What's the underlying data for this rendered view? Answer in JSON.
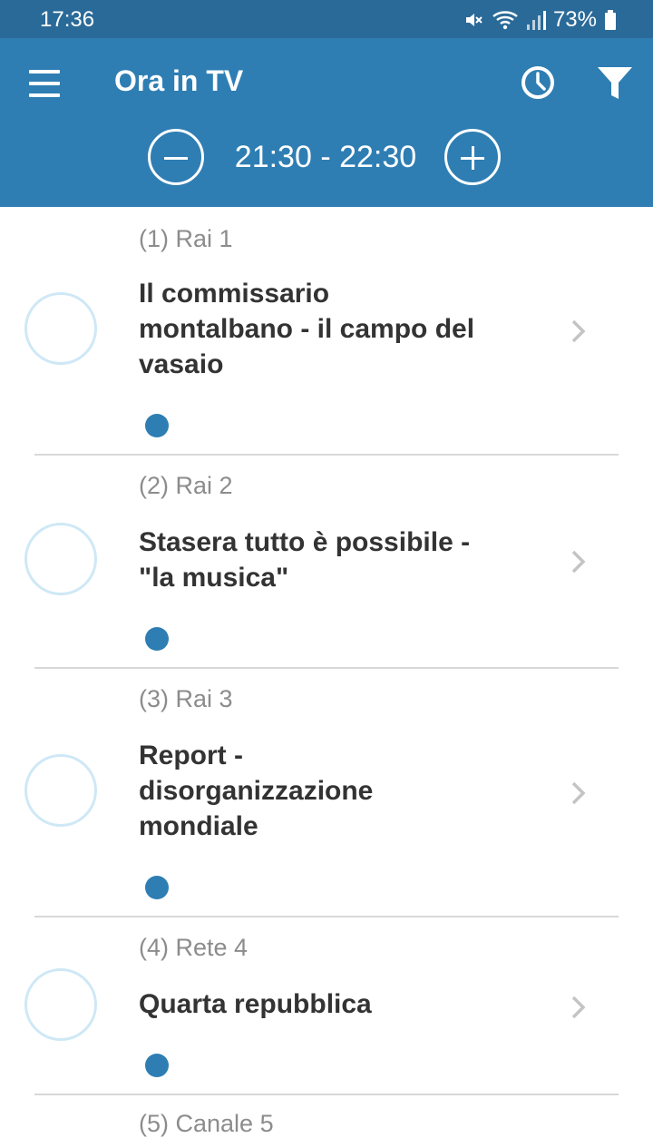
{
  "status_bar": {
    "time": "17:36",
    "battery": "73%",
    "icons": [
      "mute-icon",
      "wifi-icon",
      "signal-icon",
      "battery-icon"
    ]
  },
  "header": {
    "title": "Ora in TV",
    "time_range": "21:30 - 22:30",
    "icons": [
      "menu-icon",
      "clock-icon",
      "filter-icon",
      "minus-icon",
      "plus-icon"
    ]
  },
  "colors": {
    "primary": "#2e7eb3",
    "status_bar": "#2a6a98",
    "ring": "#cfe8f6",
    "channel_text": "#8c8c8c",
    "title_text": "#333333"
  },
  "programs": [
    {
      "channel": "(1) Rai 1",
      "title_lines": [
        "Il commissario",
        "montalbano - il campo del",
        "vasaio"
      ]
    },
    {
      "channel": "(2) Rai 2",
      "title_lines": [
        "Stasera tutto è possibile -",
        "\"la musica\""
      ]
    },
    {
      "channel": "(3) Rai 3",
      "title_lines": [
        "Report -",
        "disorganizzazione",
        "mondiale"
      ]
    },
    {
      "channel": "(4) Rete 4",
      "title_lines": [
        "Quarta repubblica"
      ]
    },
    {
      "channel": "(5) Canale 5",
      "title_lines": []
    }
  ]
}
